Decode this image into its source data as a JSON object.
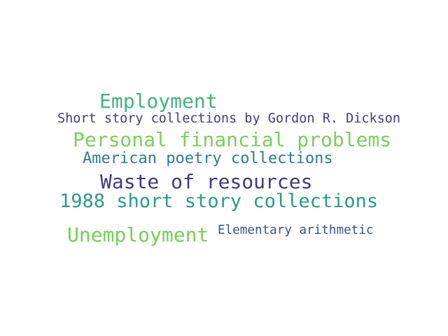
{
  "words": [
    {
      "text": "Employment",
      "color": "#3fb47a"
    },
    {
      "text": "Short story collections by Gordon R. Dickson",
      "color": "#443a83"
    },
    {
      "text": "Personal financial problems",
      "color": "#7ccf5a"
    },
    {
      "text": "American poetry collections",
      "color": "#2c7e8e"
    },
    {
      "text": "Waste of resources",
      "color": "#453781"
    },
    {
      "text": "1988 short story collections",
      "color": "#2a9a8c"
    },
    {
      "text": "Unemployment",
      "color": "#74d055"
    },
    {
      "text": "Elementary arithmetic",
      "color": "#3b528b"
    }
  ]
}
